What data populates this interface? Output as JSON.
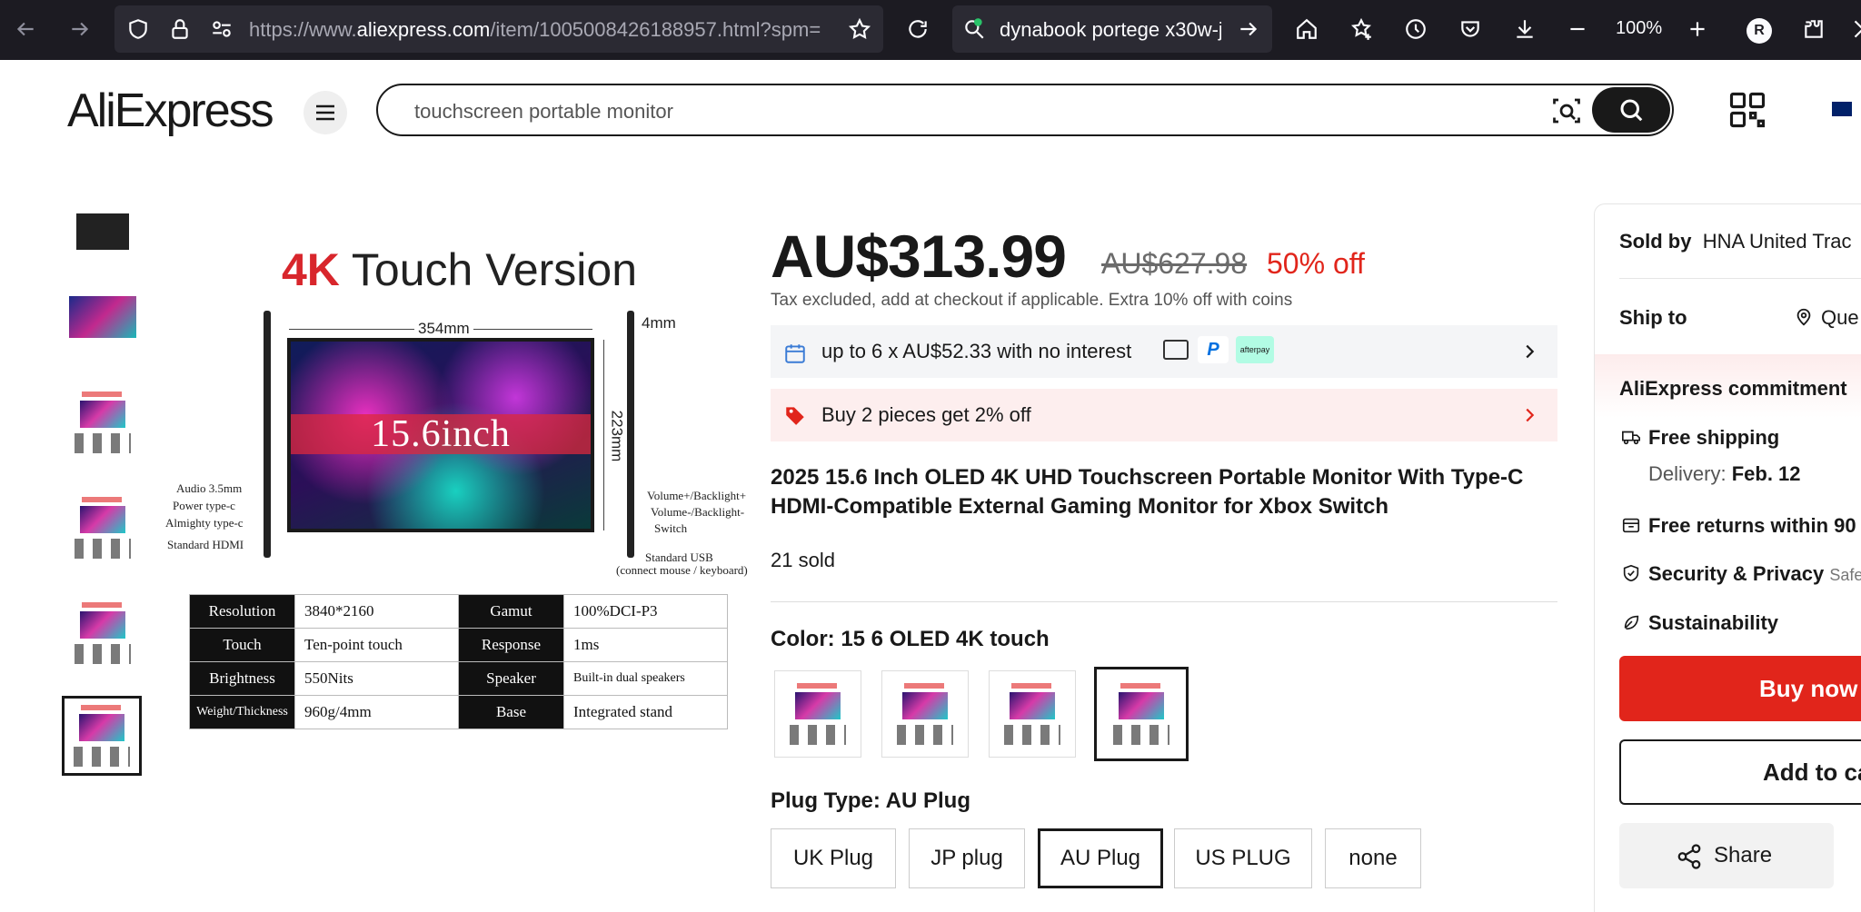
{
  "browser": {
    "url_prefix": "https://www.",
    "url_domain": "aliexpress.com",
    "url_rest": "/item/1005008426188957.html?spm=",
    "search_query": "dynabook portege x30w-j",
    "zoom": "100%",
    "profile_initial": "R"
  },
  "site": {
    "logo": "AliExpress",
    "search_text": "touchscreen portable monitor"
  },
  "gallery": {
    "title_prefix": "4K",
    "title_rest": " Touch Version",
    "screen_size": "15.6inch",
    "width_dim": "354mm",
    "height_dim": "223mm",
    "depth_dim": "4mm",
    "ports_left": [
      "Audio 3.5mm",
      "Power type-c",
      "Almighty type-c",
      "Standard HDMI"
    ],
    "ports_right": [
      "Volume+/Backlight+",
      "Volume-/Backlight-",
      "Switch"
    ],
    "usb_label": "Standard USB",
    "usb_note": "(connect mouse / keyboard)",
    "specs": [
      [
        "Resolution",
        "3840*2160",
        "Gamut",
        "100%DCI-P3"
      ],
      [
        "Touch",
        "Ten-point touch",
        "Response",
        "1ms"
      ],
      [
        "Brightness",
        "550Nits",
        "Speaker",
        "Built-in dual speakers"
      ],
      [
        "Weight/Thickness",
        "960g/4mm",
        "Base",
        "Integrated stand"
      ]
    ]
  },
  "product": {
    "price": "AU$313.99",
    "original_price": "AU$627.98",
    "discount": "50% off",
    "tax_note": "Tax excluded, add at checkout if applicable. Extra 10% off with coins",
    "installment": "up to 6 x AU$52.33 with no interest",
    "afterpay": "afterpay",
    "promo": "Buy 2 pieces get 2% off",
    "title": "2025 15.6 Inch OLED 4K UHD Touchscreen Portable Monitor With Type-C HDMI-Compatible External Gaming Monitor for Xbox Switch",
    "sold": "21 sold",
    "color_label": "Color: 15 6 OLED 4K touch",
    "plug_label": "Plug Type: AU Plug",
    "plugs": [
      "UK Plug",
      "JP plug",
      "AU Plug",
      "US PLUG",
      "none"
    ]
  },
  "panel": {
    "sold_by_label": "Sold by",
    "sold_by_value": "HNA United Trac",
    "ship_to_label": "Ship to",
    "ship_to_value": "Que",
    "commitment": "AliExpress commitment",
    "free_shipping": "Free shipping",
    "delivery_label": "Delivery:",
    "delivery_date": "Feb. 12",
    "free_returns": "Free returns within 90",
    "security": "Security & Privacy",
    "security_note": "Safe",
    "sustainability": "Sustainability",
    "buy_now": "Buy now",
    "add_to_cart": "Add to cart",
    "share": "Share"
  },
  "colors": {
    "accent_red": "#e1251b",
    "browser_bg": "#1c1b22"
  }
}
